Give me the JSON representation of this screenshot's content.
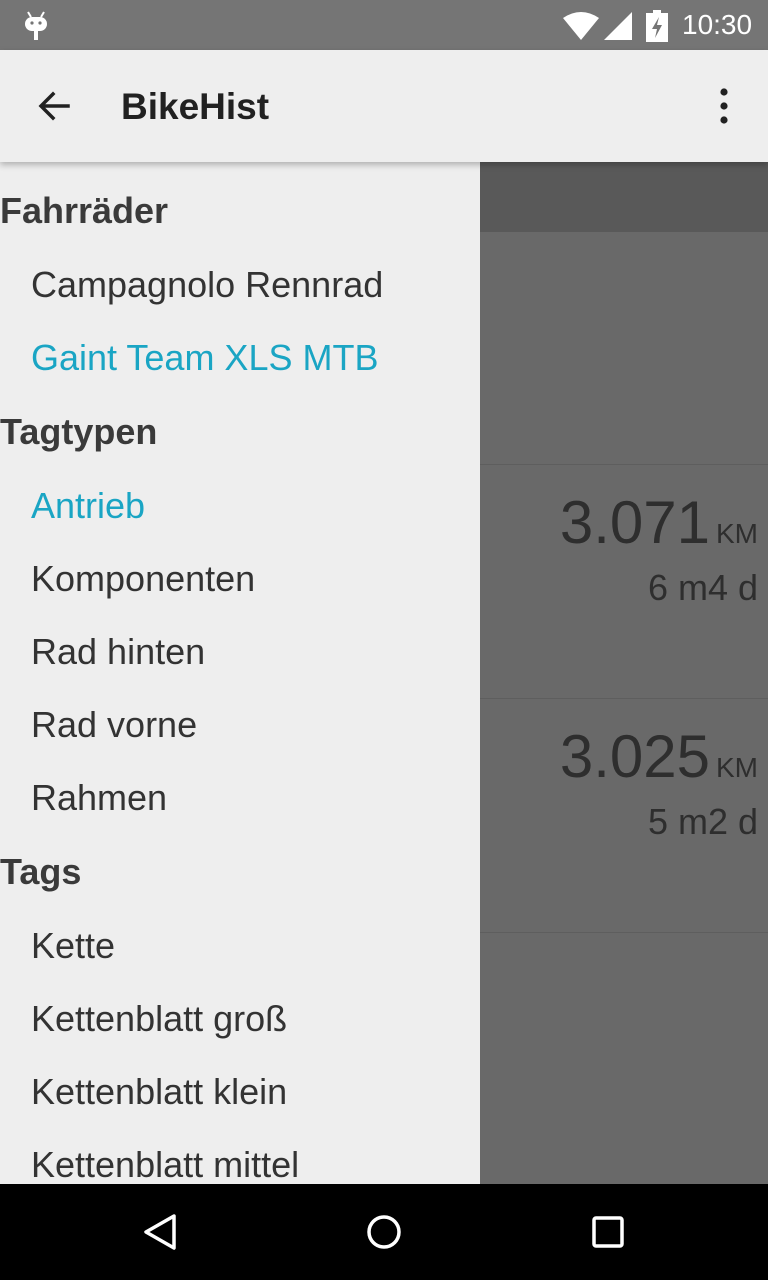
{
  "status_bar": {
    "time": "10:30",
    "icons": [
      "android-debug-icon",
      "wifi-icon",
      "cell-signal-icon",
      "battery-charging-icon"
    ]
  },
  "app_bar": {
    "title": "BikeHist",
    "back_icon": "arrow-back-icon",
    "overflow_icon": "more-vert-icon"
  },
  "drawer": {
    "sections": [
      {
        "header": "Fahrräder",
        "items": [
          {
            "label": "Campagnolo Rennrad",
            "selected": false
          },
          {
            "label": "Gaint Team XLS MTB",
            "selected": true
          }
        ]
      },
      {
        "header": "Tagtypen",
        "items": [
          {
            "label": "Antrieb",
            "selected": true
          },
          {
            "label": "Komponenten",
            "selected": false
          },
          {
            "label": "Rad hinten",
            "selected": false
          },
          {
            "label": "Rad vorne",
            "selected": false
          },
          {
            "label": "Rahmen",
            "selected": false
          }
        ]
      },
      {
        "header": "Tags",
        "items": [
          {
            "label": "Kette",
            "selected": false
          },
          {
            "label": "Kettenblatt groß",
            "selected": false
          },
          {
            "label": "Kettenblatt klein",
            "selected": false
          },
          {
            "label": "Kettenblatt mittel",
            "selected": false
          }
        ]
      }
    ]
  },
  "background": {
    "cards": [
      {
        "km": "3.071",
        "unit": "KM",
        "duration": "6 m4 d"
      },
      {
        "km": "3.025",
        "unit": "KM",
        "duration": "5 m2 d"
      }
    ]
  },
  "colors": {
    "accent": "#1aa5c4",
    "app_bar": "#eeeeee",
    "status_bar": "#757575",
    "scrim": "#696969"
  }
}
